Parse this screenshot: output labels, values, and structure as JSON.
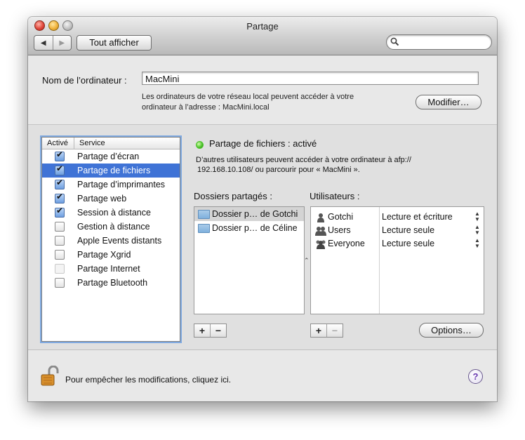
{
  "window": {
    "title": "Partage",
    "back_icon": "◀",
    "forward_icon": "▶",
    "show_all_label": "Tout afficher",
    "search_placeholder": ""
  },
  "computer": {
    "name_label": "Nom de l’ordinateur :",
    "name_value": "MacMini",
    "description_line1": "Les ordinateurs de votre réseau local peuvent accéder à votre",
    "description_line2": "ordinateur à l’adresse : MacMini.local",
    "modify_label": "Modifier…"
  },
  "services": {
    "header_active": "Activé",
    "header_service": "Service",
    "items": [
      {
        "label": "Partage d’écran",
        "checked": true
      },
      {
        "label": "Partage de fichiers",
        "checked": true,
        "selected": true
      },
      {
        "label": "Partage d’imprimantes",
        "checked": true
      },
      {
        "label": "Partage web",
        "checked": true
      },
      {
        "label": "Session à distance",
        "checked": true
      },
      {
        "label": "Gestion à distance",
        "checked": false
      },
      {
        "label": "Apple Events distants",
        "checked": false
      },
      {
        "label": "Partage Xgrid",
        "checked": false
      },
      {
        "label": "Partage Internet",
        "checked": false,
        "disabled": true
      },
      {
        "label": "Partage Bluetooth",
        "checked": false
      }
    ]
  },
  "detail": {
    "status": "Partage de fichiers : activé",
    "status_color": "#4bc22a",
    "info_line1": "D’autres utilisateurs peuvent accéder à votre ordinateur à afp://",
    "info_line2": "192.168.10.108/ ou parcourir pour « MacMini ».",
    "shared_folders_label": "Dossiers partagés :",
    "users_label": "Utilisateurs :",
    "folders": [
      {
        "name": "Dossier p… de Gotchi",
        "selected": true
      },
      {
        "name": "Dossier p… de Céline",
        "selected": false
      }
    ],
    "users": [
      {
        "name": "Gotchi",
        "permission": "Lecture et écriture",
        "icon": "user-icon"
      },
      {
        "name": "Users",
        "permission": "Lecture seule",
        "icon": "group-icon"
      },
      {
        "name": "Everyone",
        "permission": "Lecture seule",
        "icon": "everyone-icon"
      }
    ],
    "add_label": "+",
    "remove_label": "−",
    "options_label": "Options…"
  },
  "footer": {
    "lock_text": "Pour empêcher les modifications, cliquez ici.",
    "help_label": "?"
  }
}
